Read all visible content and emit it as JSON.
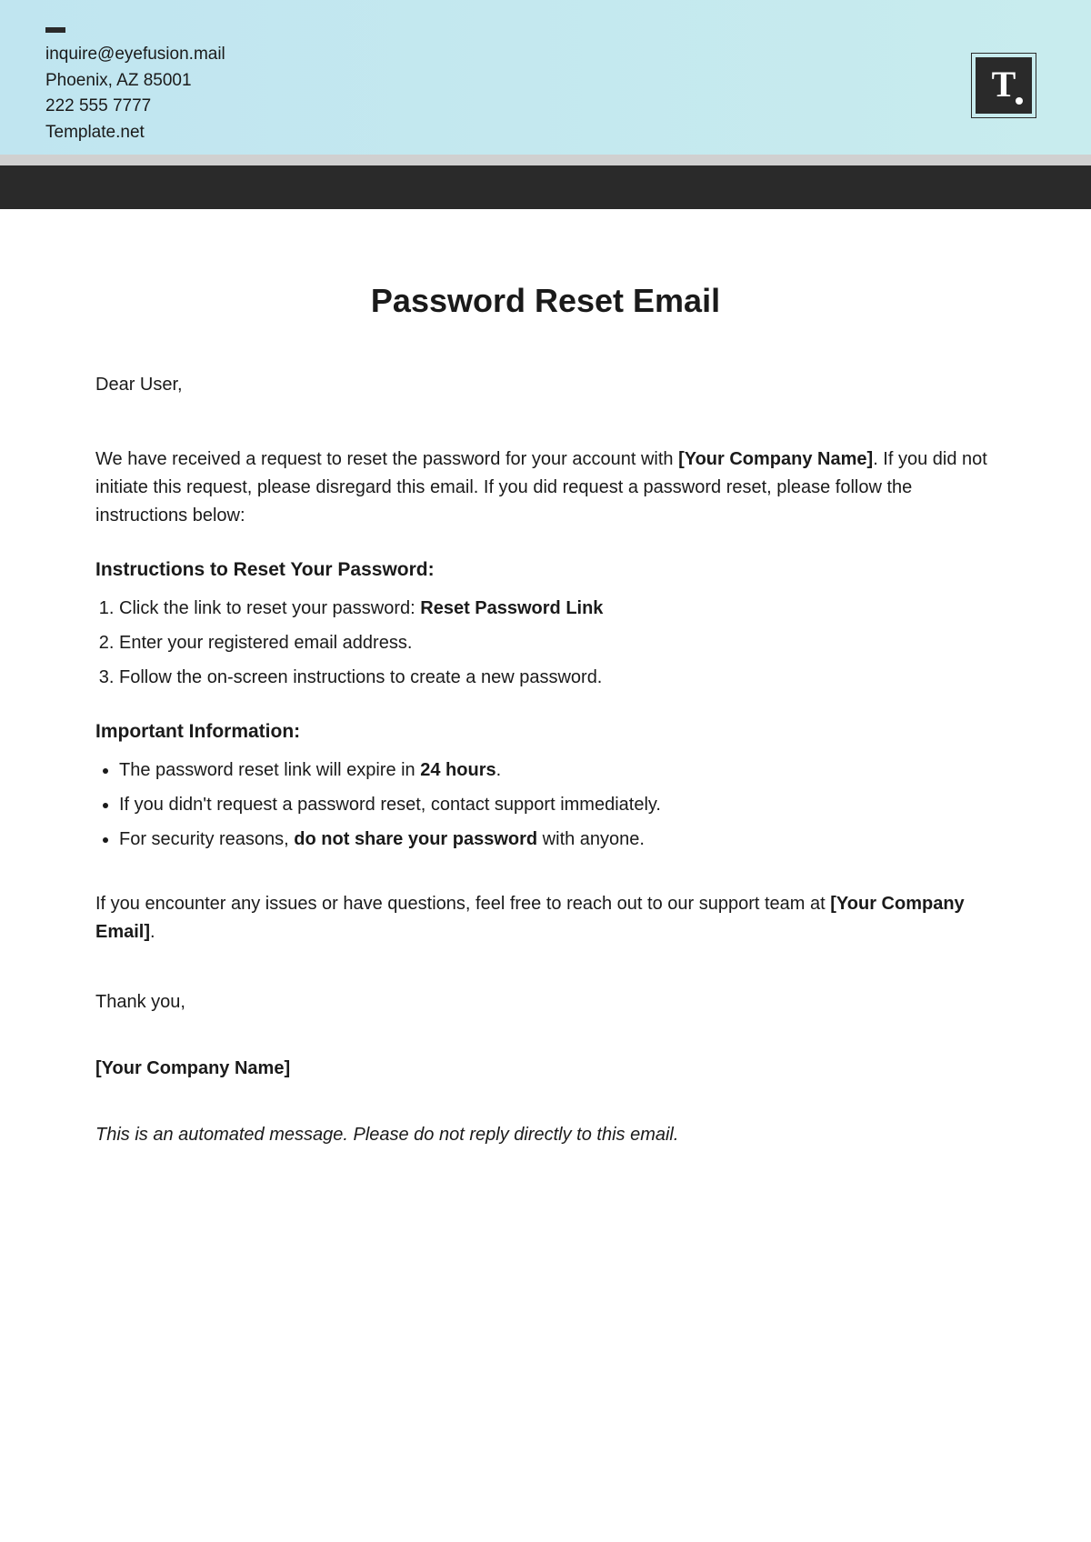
{
  "header": {
    "email": "inquire@eyefusion.mail",
    "address": "Phoenix, AZ 85001",
    "phone": "222 555 7777",
    "website": "Template.net",
    "logo_letter": "T"
  },
  "document": {
    "title": "Password Reset Email",
    "greeting": "Dear User,",
    "intro_prefix": "We have received a request to reset the password for your account with ",
    "company_placeholder": "[Your Company Name]",
    "intro_suffix": ". If you did not initiate this request, please disregard this email. If you did request a password reset, please follow the instructions below:",
    "instructions_heading": "Instructions to Reset Your Password:",
    "instructions": {
      "item1_prefix": "Click the link to reset your password: ",
      "item1_link": "Reset Password Link",
      "item2": "Enter your registered email address.",
      "item3": "Follow the on-screen instructions to create a new password."
    },
    "important_heading": "Important Information:",
    "important": {
      "item1_prefix": "The password reset link will expire in ",
      "item1_bold": "24 hours",
      "item1_suffix": ".",
      "item2": "If you didn't request a password reset, contact support immediately.",
      "item3_prefix": "For security reasons, ",
      "item3_bold": "do not share your password",
      "item3_suffix": " with anyone."
    },
    "support_prefix": "If you encounter any issues or have questions, feel free to reach out to our support team at ",
    "support_email_placeholder": "[Your Company Email]",
    "support_suffix": ".",
    "thank_you": "Thank you,",
    "signature": "[Your Company Name]",
    "automated_note": "This is an automated message. Please do not reply directly to this email."
  }
}
